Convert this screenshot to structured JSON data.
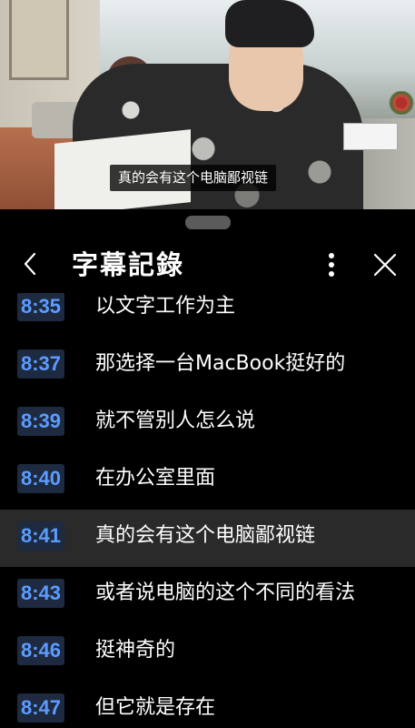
{
  "video": {
    "subtitle": "真的会有这个电脑鄙视链"
  },
  "panel": {
    "title": "字幕記錄",
    "icons": {
      "back": "chevron-left-icon",
      "more": "vertical-ellipsis-icon",
      "close": "close-icon"
    },
    "accent_color": "#5d9cff",
    "rows": [
      {
        "time": "8:35",
        "text": "以文字工作为主",
        "active": false
      },
      {
        "time": "8:37",
        "text": "那选择一台MacBook挺好的",
        "active": false
      },
      {
        "time": "8:39",
        "text": "就不管别人怎么说",
        "active": false
      },
      {
        "time": "8:40",
        "text": "在办公室里面",
        "active": false
      },
      {
        "time": "8:41",
        "text": "真的会有这个电脑鄙视链",
        "active": true
      },
      {
        "time": "8:43",
        "text": "或者说电脑的这个不同的看法",
        "active": false
      },
      {
        "time": "8:46",
        "text": "挺神奇的",
        "active": false
      },
      {
        "time": "8:47",
        "text": "但它就是存在",
        "active": false
      }
    ]
  }
}
